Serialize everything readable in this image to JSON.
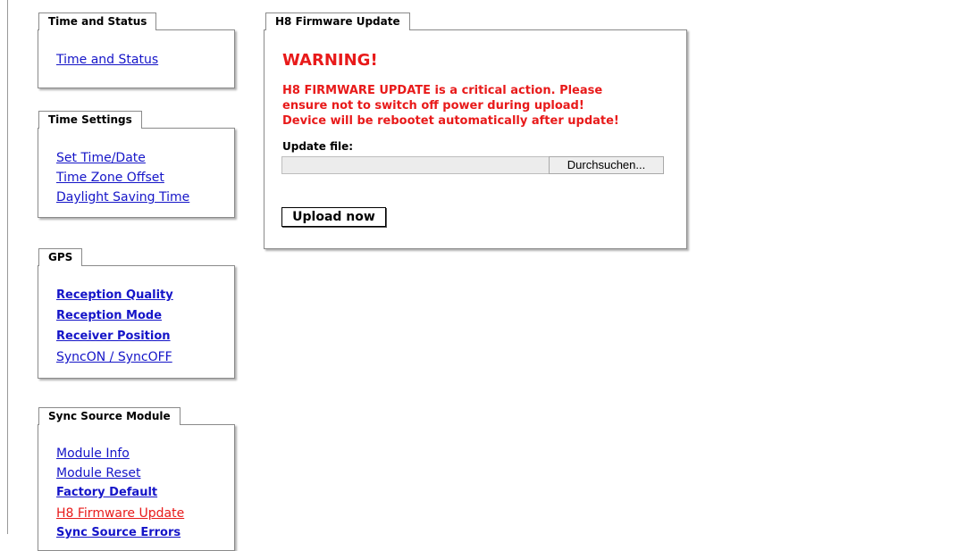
{
  "sidebar": {
    "time_status": {
      "tab": "Time and Status",
      "links": [
        "Time and Status"
      ]
    },
    "time_settings": {
      "tab": "Time Settings",
      "links": [
        "Set Time/Date",
        "Time Zone Offset",
        "Daylight Saving Time"
      ]
    },
    "gps": {
      "tab": "GPS",
      "links": [
        "Reception Quality",
        "Reception Mode",
        "Receiver Position",
        "SyncON / SyncOFF"
      ]
    },
    "sync_source": {
      "tab": "Sync Source Module",
      "links": [
        "Module Info",
        "Module Reset",
        "Factory Default",
        "H8 Firmware Update",
        "Sync Source Errors"
      ],
      "active_index": 3
    }
  },
  "main": {
    "tab": "H8 Firmware Update",
    "warning_title": "WARNING!",
    "warning_lines": [
      "H8 FIRMWARE UPDATE is a critical action. Please",
      "ensure not to switch off power during upload!",
      "Device will be rebootet automatically after update!"
    ],
    "file_label": "Update file:",
    "file_value": "",
    "browse_label": "Durchsuchen...",
    "upload_label": "Upload now"
  },
  "colors": {
    "link": "#1515c8",
    "active_link": "#e81a1a",
    "warning": "#e81a1a",
    "border": "#8a8a8a"
  }
}
